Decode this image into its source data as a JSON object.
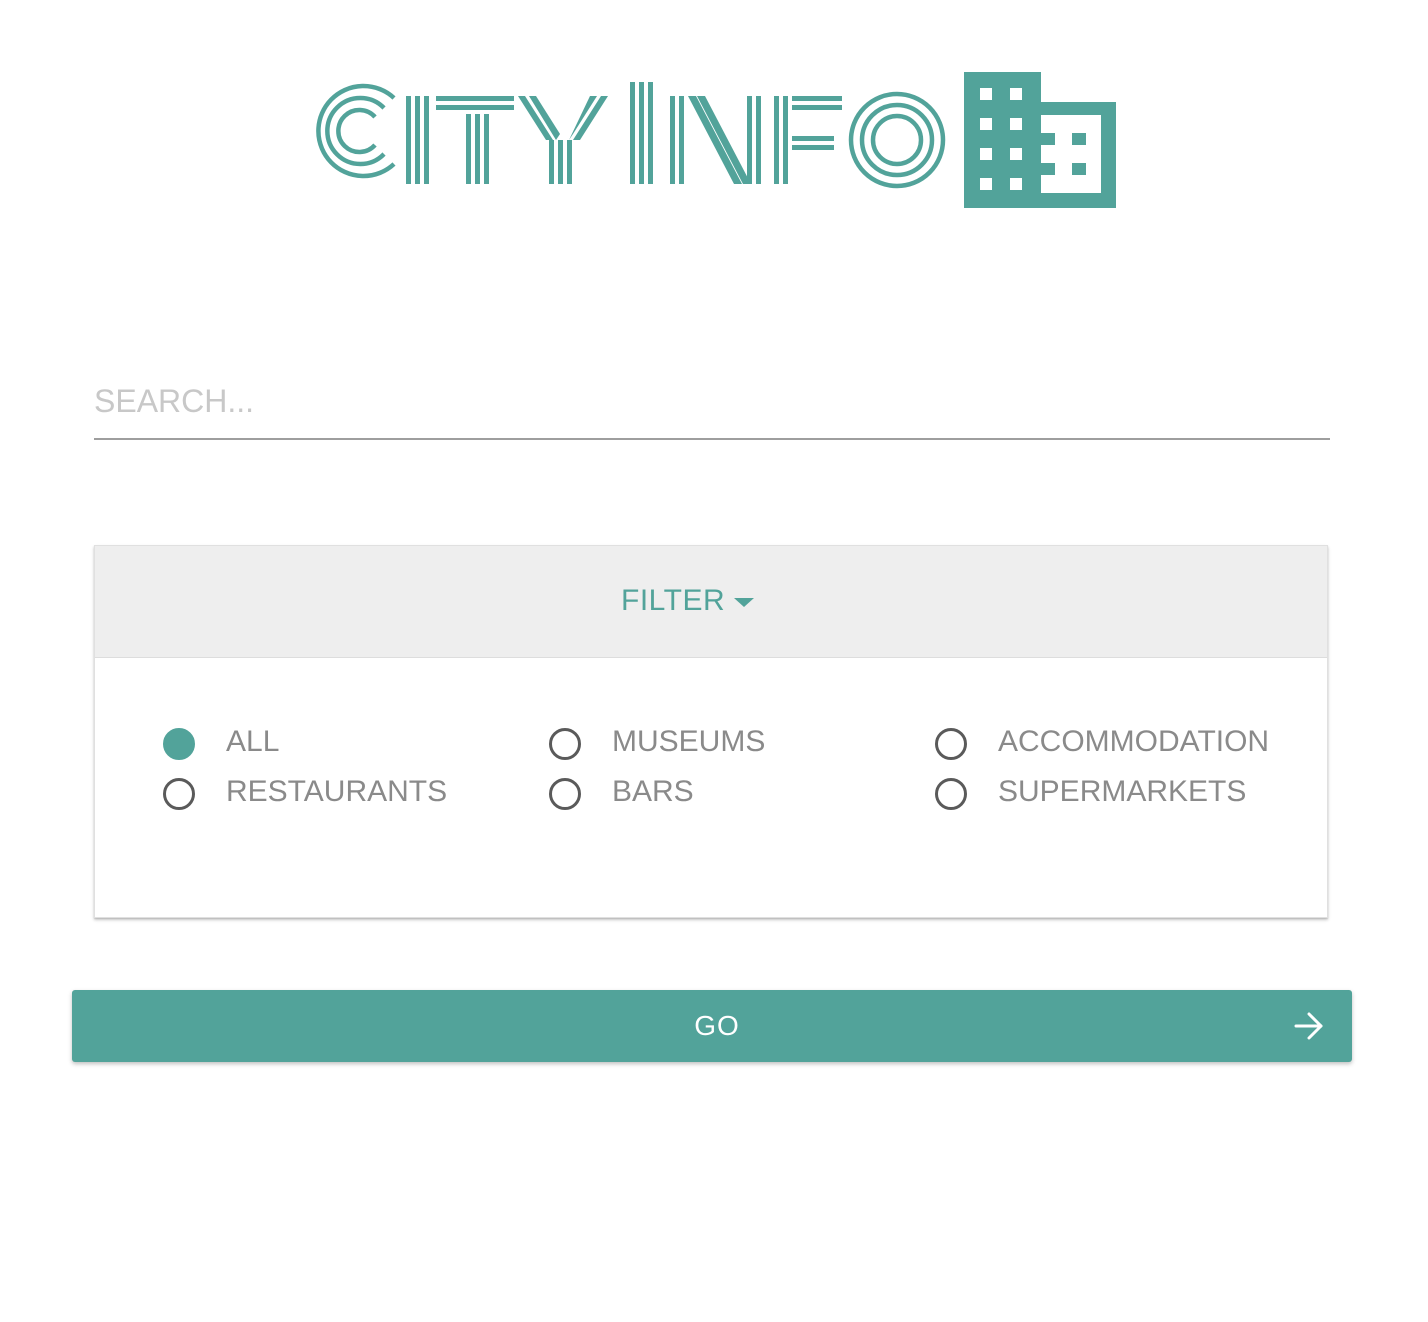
{
  "app": {
    "logo_text": "CITY INFO",
    "logo_icon": "building-icon",
    "accent_color": "#52a39a"
  },
  "search": {
    "value": "",
    "placeholder": "SEARCH..."
  },
  "filter": {
    "header_label": "FILTER",
    "header_icon": "caret-down-icon",
    "selected": "ALL",
    "options": [
      {
        "label": "ALL",
        "checked": true
      },
      {
        "label": "MUSEUMS",
        "checked": false
      },
      {
        "label": "ACCOMMODATION",
        "checked": false
      },
      {
        "label": "RESTAURANTS",
        "checked": false
      },
      {
        "label": "BARS",
        "checked": false
      },
      {
        "label": "SUPERMARKETS",
        "checked": false
      }
    ]
  },
  "go_button": {
    "label": "GO",
    "icon": "arrow-right-icon"
  }
}
